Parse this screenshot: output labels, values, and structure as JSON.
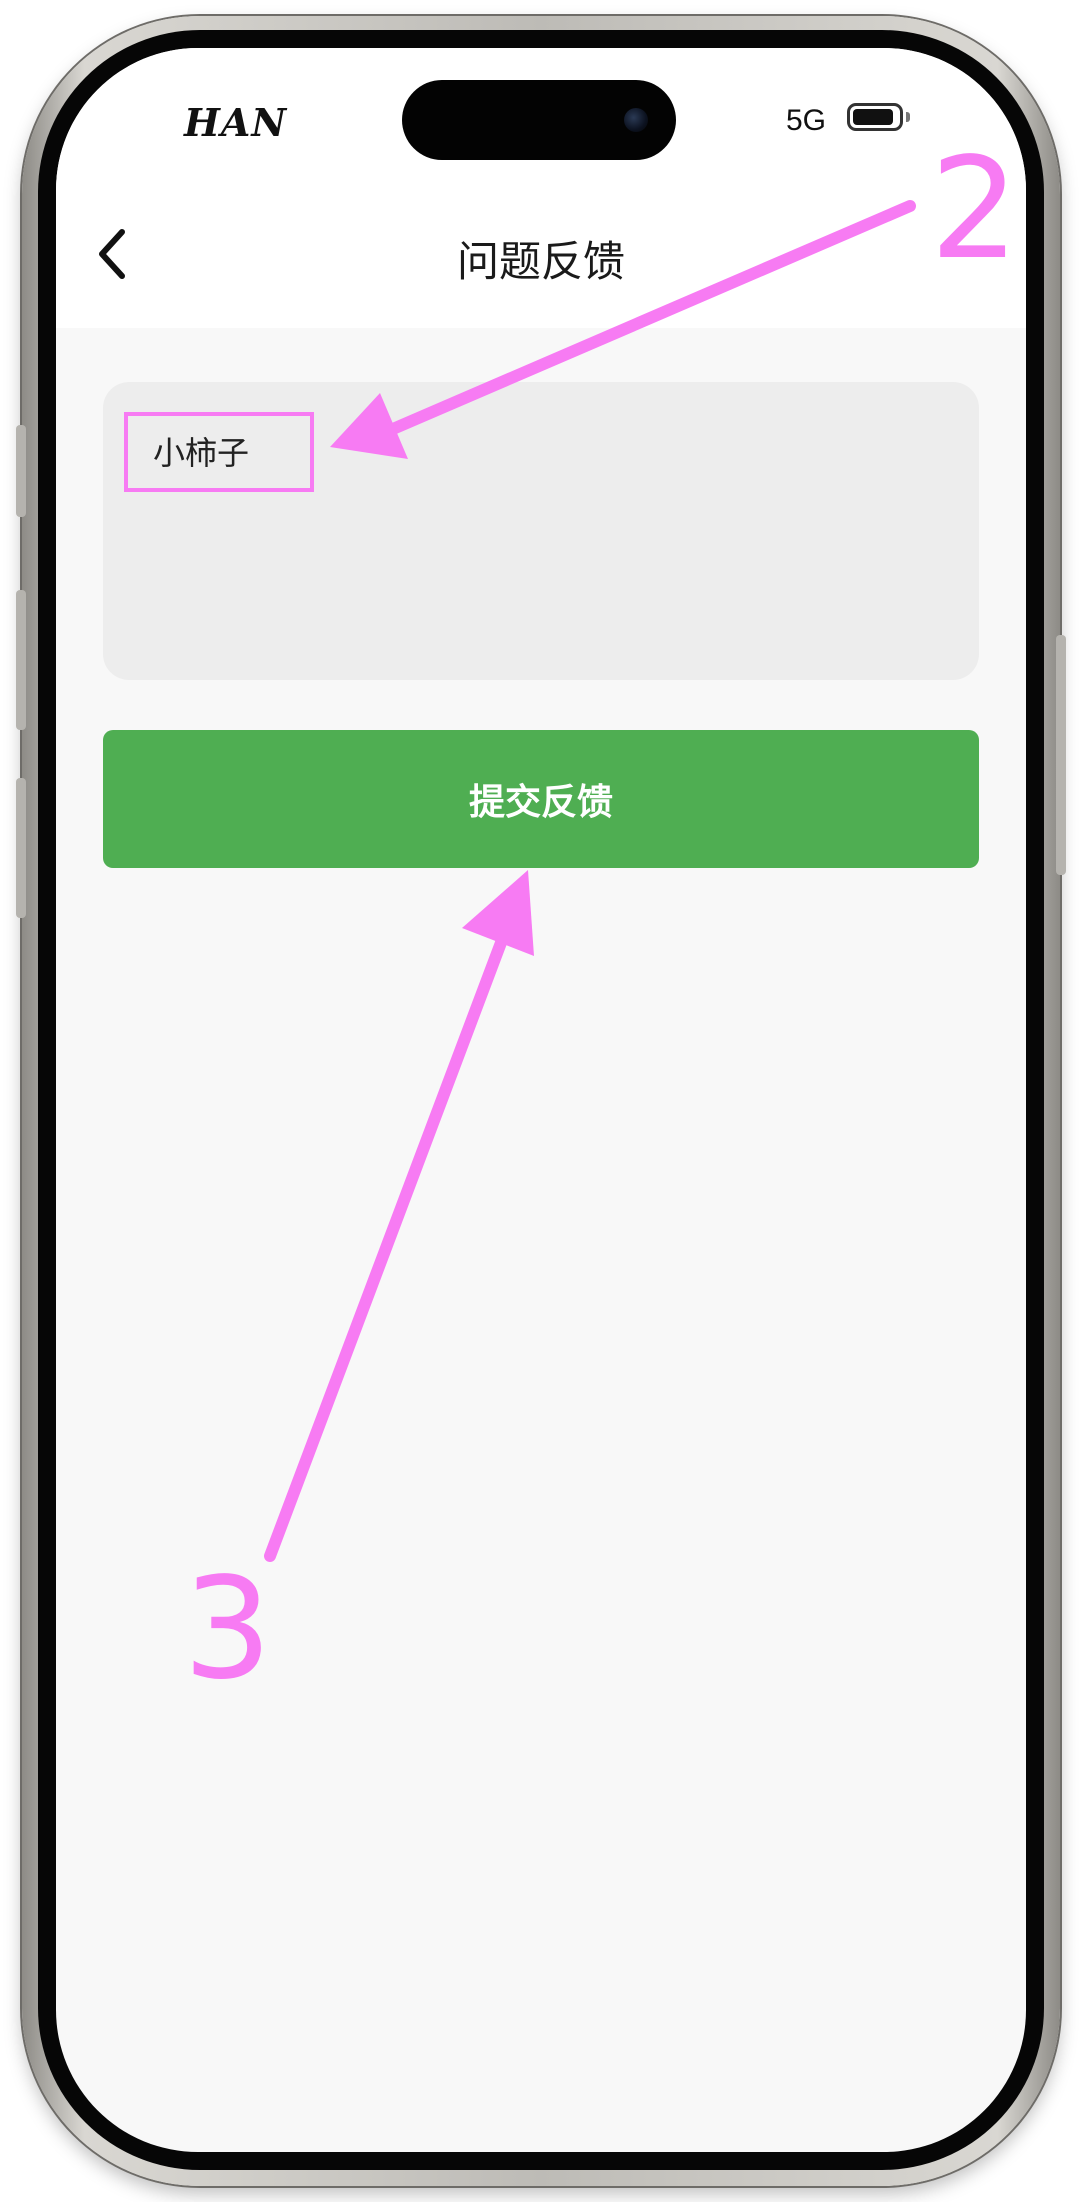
{
  "status_bar": {
    "carrier": "HAN",
    "network": "5G"
  },
  "nav": {
    "back_icon": "chevron-left-icon",
    "title": "问题反馈"
  },
  "feedback": {
    "input_value": "小柿子"
  },
  "submit": {
    "label": "提交反馈"
  },
  "annotations": {
    "label_2": "2",
    "label_3": "3"
  },
  "colors": {
    "accent_green": "#4fae52",
    "annotation_pink": "#f77bf3",
    "input_background": "#ededed",
    "page_background": "#f8f8f8"
  }
}
